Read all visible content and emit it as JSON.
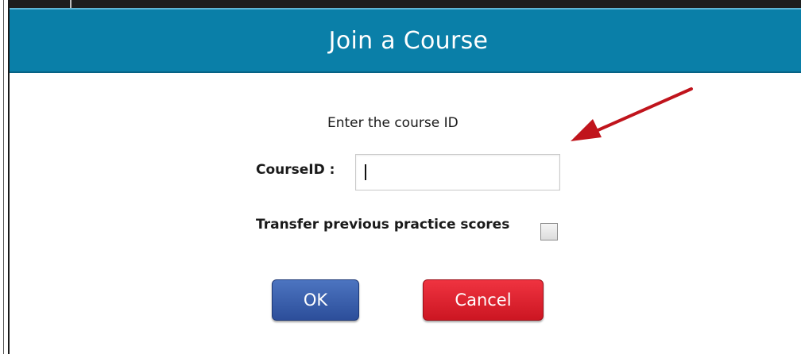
{
  "dialog": {
    "title": "Join a Course",
    "prompt": "Enter the course ID",
    "course_id": {
      "label": "CourseID :",
      "value": "",
      "placeholder": ""
    },
    "transfer": {
      "label": "Transfer previous practice scores",
      "checked": false
    },
    "buttons": {
      "ok_label": "OK",
      "cancel_label": "Cancel"
    }
  },
  "colors": {
    "header": "#0a7fa8",
    "ok_button": "#2c4e9a",
    "cancel_button": "#cc1622",
    "annotation_arrow": "#c0141c"
  },
  "annotation": {
    "icon": "red-arrow-icon"
  }
}
